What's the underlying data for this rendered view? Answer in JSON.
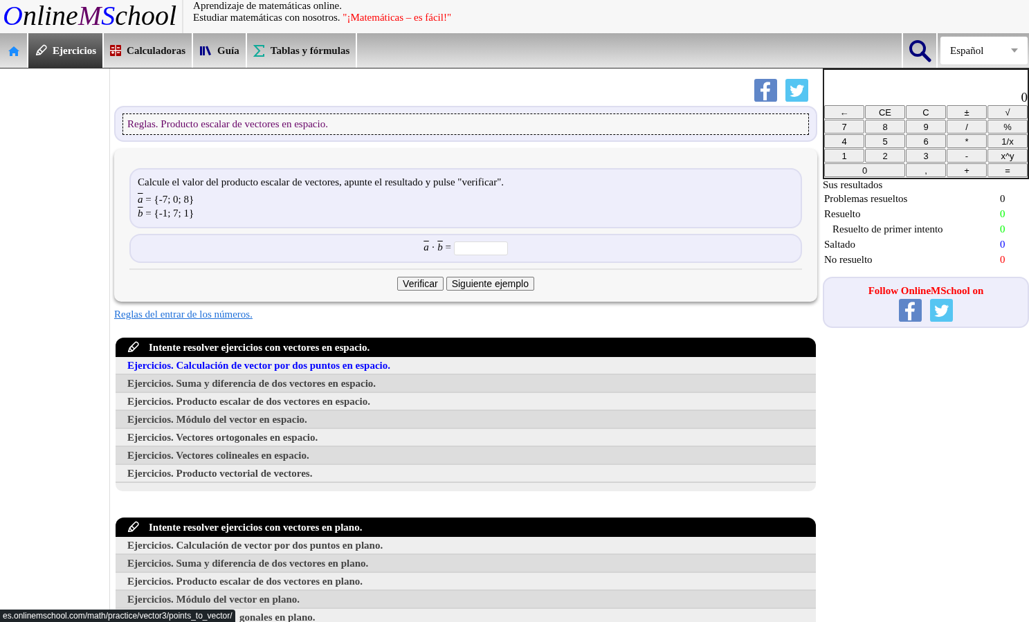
{
  "logo": [
    {
      "text": "O",
      "color": "#0000ff"
    },
    {
      "text": "nline",
      "color": "#000000"
    },
    {
      "text": "M",
      "color": "#660066"
    },
    {
      "text": "S",
      "color": "#0000ff"
    },
    {
      "text": "chool",
      "color": "#000000"
    }
  ],
  "tagline": {
    "line1": "Aprendizaje de matemáticas online.",
    "line2": "Estudiar matemáticas con nosotros.",
    "slogan": "\"¡Matemáticas – es fácil!\""
  },
  "nav": [
    {
      "kind": "home",
      "selected": false
    },
    {
      "kind": "pencil",
      "label": "Ejercicios",
      "selected": true
    },
    {
      "kind": "calculator",
      "label": "Calculadoras",
      "selected": false
    },
    {
      "kind": "books",
      "label": "Guía",
      "selected": false
    },
    {
      "kind": "sigma",
      "label": "Tablas y fórmulas",
      "selected": false
    }
  ],
  "language": "Español",
  "rules_link": "Reglas. Producto escalar de vectores en espacio.",
  "task": {
    "instruction": "Calcule el valor del producto escalar de vectores, apunte el resultado y pulse \"verificar\".",
    "vectors": [
      {
        "name": "a",
        "value": "= {-7; 0; 8}"
      },
      {
        "name": "b",
        "value": "= {-1; 7; 1}"
      }
    ],
    "answer": {
      "left": "a",
      "op": "·",
      "right": "b",
      "eq": "="
    },
    "buttons": [
      "Verificar",
      "Siguiente ejemplo"
    ]
  },
  "input_rules_link": "Reglas del entrar de los números.",
  "sections": [
    {
      "title": "Intente resolver ejercicios con vectores en espacio.",
      "items": [
        {
          "text": "Ejercicios. Calculación de vector por dos puntos en espacio.",
          "selected": true,
          "kind": "full"
        },
        {
          "text": "Ejercicios. Suma y diferencia de dos vectores en espacio.",
          "selected": false,
          "kind": "full"
        },
        {
          "text": "Ejercicios. Producto escalar de dos vectores en espacio.",
          "selected": false,
          "kind": "full"
        },
        {
          "text": "Ejercicios. Módulo del vector en espacio.",
          "selected": false,
          "kind": "full"
        },
        {
          "text": "Ejercicios. Vectores ortogonales en espacio.",
          "selected": false,
          "kind": "full"
        },
        {
          "text": "Ejercicios. Vectores colineales en espacio.",
          "selected": false,
          "kind": "full"
        },
        {
          "text": "Ejercicios. Producto vectorial de vectores.",
          "selected": false,
          "kind": "full"
        }
      ]
    },
    {
      "title": "Intente resolver ejercicios con vectores en plano.",
      "items": [
        {
          "text": "Ejercicios. Calculación de vector por dos puntos en plano.",
          "selected": false,
          "kind": "full"
        },
        {
          "text": "Ejercicios. Suma y diferencia de dos vectores en plano.",
          "selected": false,
          "kind": "full"
        },
        {
          "text": "Ejercicios. Producto escalar de dos vectores en plano.",
          "selected": false,
          "kind": "full"
        },
        {
          "text": "Ejercicios. Módulo del vector en plano.",
          "selected": false,
          "kind": "full"
        },
        {
          "text": "gonales en plano.",
          "selected": false,
          "kind": "partial"
        }
      ]
    }
  ],
  "calculator": {
    "display": "0",
    "keys": [
      {
        "label": "←",
        "kind": "key"
      },
      {
        "label": "CE",
        "kind": "key"
      },
      {
        "label": "C",
        "kind": "key"
      },
      {
        "label": "±",
        "kind": "key"
      },
      {
        "label": "√",
        "kind": "key"
      },
      {
        "label": "7",
        "kind": "key"
      },
      {
        "label": "8",
        "kind": "key"
      },
      {
        "label": "9",
        "kind": "key"
      },
      {
        "label": "/",
        "kind": "key"
      },
      {
        "label": "%",
        "kind": "key"
      },
      {
        "label": "4",
        "kind": "key"
      },
      {
        "label": "5",
        "kind": "key"
      },
      {
        "label": "6",
        "kind": "key"
      },
      {
        "label": "*",
        "kind": "key"
      },
      {
        "label": "1/x",
        "kind": "key"
      },
      {
        "label": "1",
        "kind": "key"
      },
      {
        "label": "2",
        "kind": "key"
      },
      {
        "label": "3",
        "kind": "key"
      },
      {
        "label": "-",
        "kind": "key"
      },
      {
        "label": "x^y",
        "kind": "key"
      },
      {
        "label": "0",
        "kind": "wide"
      },
      {
        "label": ",",
        "kind": "key"
      },
      {
        "label": "+",
        "kind": "key"
      },
      {
        "label": "=",
        "kind": "key"
      }
    ]
  },
  "results": {
    "title": "Sus resultados",
    "rows": [
      {
        "label": "Problemas resueltos",
        "value": "0",
        "color": "#000000"
      },
      {
        "label": "Resuelto",
        "value": "0",
        "color": "#00ff00",
        "children": [
          {
            "label": "Resuelto de primer intento",
            "value": "0",
            "color": "#00ff00"
          }
        ]
      },
      {
        "label": "Saltado",
        "value": "0",
        "color": "#0000ff"
      },
      {
        "label": "No resuelto",
        "value": "0",
        "color": "#ff0000"
      }
    ]
  },
  "follow": {
    "title": "Follow OnlineMSchool on"
  },
  "status_bar": "es.onlinemschool.com/math/practice/vector3/points_to_vector/"
}
